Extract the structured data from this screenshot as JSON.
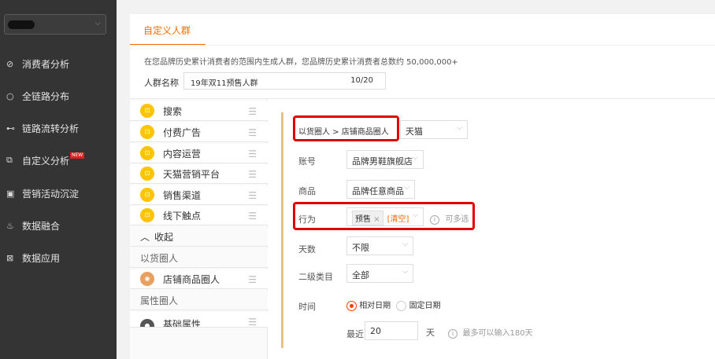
{
  "sidebar": {
    "items": [
      {
        "icon": "⊘",
        "icon_name": "consumer-analysis-icon",
        "label": "消费者分析"
      },
      {
        "icon": "○",
        "icon_name": "full-chain-icon",
        "label": "全链路分布"
      },
      {
        "icon": "⊷",
        "icon_name": "chain-flow-icon",
        "label": "链路流转分析"
      },
      {
        "icon": "⧉",
        "icon_name": "custom-analysis-icon",
        "label": "自定义分析",
        "badge": "NEW"
      },
      {
        "icon": "▣",
        "icon_name": "campaign-icon",
        "label": "营销活动沉淀"
      },
      {
        "icon": "♨",
        "icon_name": "data-fusion-icon",
        "label": "数据融合"
      },
      {
        "icon": "⊠",
        "icon_name": "data-app-icon",
        "label": "数据应用"
      }
    ]
  },
  "main": {
    "tab": "自定义人群",
    "description": "在您品牌历史累计消费者的范围内生成人群，您品牌历史累计消费者总数约 50,000,000+",
    "name_label": "人群名称",
    "name_value": "19年双11预售人群",
    "name_count": "10/20"
  },
  "categories": [
    {
      "label": "搜索",
      "icon_name": "search-category-icon"
    },
    {
      "label": "付费广告",
      "icon_name": "paid-ads-category-icon"
    },
    {
      "label": "内容运营",
      "icon_name": "content-category-icon"
    },
    {
      "label": "天猫营销平台",
      "icon_name": "tmall-marketing-category-icon"
    },
    {
      "label": "销售渠道",
      "icon_name": "sales-channel-category-icon"
    },
    {
      "label": "线下触点",
      "icon_name": "offline-category-icon"
    }
  ],
  "collapse_label": "收起",
  "section_goods": "以货圈人",
  "shop_item": "店铺商品圈人",
  "section_attr": "属性圈人",
  "attr_item": "基础属性",
  "panel": {
    "breadcrumb": "以货圈人 > 店铺商品圈人",
    "platform": "天猫",
    "account_label": "账号",
    "account_value": "品牌男鞋旗舰店",
    "product_label": "商品",
    "product_value": "品牌任意商品",
    "behavior_label": "行为",
    "behavior_tag": "预售",
    "behavior_clear": "[清空]",
    "behavior_hint": "可多选",
    "days_label": "天数",
    "days_value": "不限",
    "category_label": "二级类目",
    "category_value": "全部",
    "time_label": "时间",
    "time_relative": "相对日期",
    "time_fixed": "固定日期",
    "recent_label": "最近",
    "recent_value": "20",
    "recent_unit": "天",
    "recent_hint": "最多可以输入180天"
  }
}
